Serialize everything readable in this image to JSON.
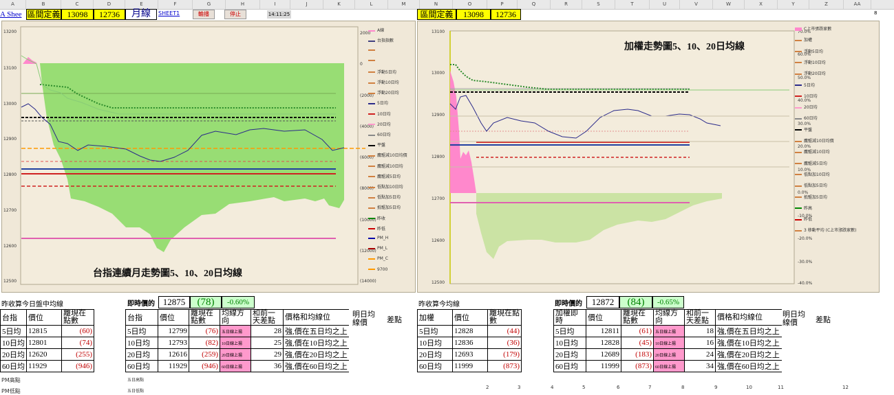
{
  "columns": [
    "A",
    "B",
    "C",
    "D",
    "E",
    "F",
    "G",
    "H",
    "I",
    "J",
    "K",
    "L",
    "M",
    "N",
    "O",
    "P",
    "Q",
    "R",
    "S",
    "T",
    "U",
    "V",
    "W",
    "X",
    "Y",
    "Z",
    "AA"
  ],
  "left_top": {
    "sheet_link": "A Shee",
    "label": "區間定義",
    "val1": "13098",
    "val2": "12736",
    "month_btn": "月線",
    "sheet_name": "SHEET1",
    "btn_rotate": "輪播",
    "btn_stop": "停止",
    "time": "14:11:25"
  },
  "right_top": {
    "label": "區間定義",
    "val1": "13098",
    "val2": "12736",
    "num8": "8"
  },
  "left_chart": {
    "title": "台指連續月走勢圖5、10、20日均線",
    "y_ticks": [
      "13200",
      "13100",
      "13000",
      "12900",
      "12800",
      "12700",
      "12600",
      "12500"
    ],
    "y2_ticks": [
      "2000",
      "0",
      "(2000)",
      "(4000)",
      "(6000)",
      "(8000)",
      "(10000)",
      "(12000)",
      "(14000)"
    ],
    "legend": [
      "A線",
      "台指指數",
      "",
      "",
      "浮動5日均",
      "浮動10日均",
      "浮動20日均",
      "5日均",
      "10日均",
      "20日均",
      "60日均",
      "平盤",
      "鷹驅減10日均價",
      "鷹驅減10日均",
      "鷹驅減5日均",
      "低點加10日均",
      "低點加5日均",
      "抵驅加5日均",
      "昨收",
      "昨低",
      "PM_H",
      "PM_L",
      "PM_C",
      "9700"
    ]
  },
  "right_chart": {
    "title": "加權走勢圖5、10、20日均線",
    "y_ticks": [
      "13100",
      "13000",
      "12900",
      "12800",
      "12700",
      "12600",
      "12500"
    ],
    "y2_ticks": [
      "70.0%",
      "60.0%",
      "50.0%",
      "40.0%",
      "30.0%",
      "20.0%",
      "10.0%",
      "0.0%",
      "-10.0%",
      "-20.0%",
      "-30.0%",
      "-40.0%"
    ],
    "legend": [
      "C上市張跌家數",
      "加權",
      "浮動5日均",
      "浮動10日均",
      "浮動20日均",
      "5日均",
      "10日均",
      "20日均",
      "60日均",
      "平盤",
      "鷹驅減10日均價",
      "鷹驅減10日均",
      "鷹驅減5日均",
      "低點加10日均",
      "低點加5日均",
      "抵驅加5日均",
      "昨高",
      "昨低",
      "3 移動平均 (C上市漲跌家數)"
    ]
  },
  "left_table1": {
    "title": "昨收算今日盤中均線",
    "headers": [
      "台指",
      "價位",
      "離現在點數"
    ],
    "rows": [
      [
        "5日均",
        "12815",
        "(60)"
      ],
      [
        "10日均",
        "12801",
        "(74)"
      ],
      [
        "20日均",
        "12620",
        "(255)"
      ],
      [
        "60日均",
        "11929",
        "(946)"
      ]
    ]
  },
  "left_table2": {
    "price_label": "即時價的",
    "price": "12875",
    "chg": "(78)",
    "pct": "-0.60%",
    "headers": [
      "台指",
      "價位",
      "離現在點數",
      "均線方向",
      "和前一天差點",
      "價格和均線位",
      "明日均線價",
      "差點"
    ],
    "rows": [
      [
        "5日均",
        "12799",
        "(76)",
        "五日線上揚",
        "28",
        "強,價在五日均之上"
      ],
      [
        "10日均",
        "12793",
        "(82)",
        "10日線上揚",
        "25",
        "強,價在10日均之上"
      ],
      [
        "20日均",
        "12616",
        "(259)",
        "20日線上揚",
        "29",
        "強,價在20日均之上"
      ],
      [
        "60日均",
        "11929",
        "(946)",
        "60日線上揚",
        "36",
        "強,價在60日均之上"
      ]
    ]
  },
  "right_table1": {
    "title": "昨收算今均線",
    "headers": [
      "加權",
      "價位",
      "離現在點數"
    ],
    "rows": [
      [
        "5日均",
        "12828",
        "(44)"
      ],
      [
        "10日均",
        "12836",
        "(36)"
      ],
      [
        "20日均",
        "12693",
        "(179)"
      ],
      [
        "60日均",
        "11999",
        "(873)"
      ]
    ]
  },
  "right_table2": {
    "price_label": "即時價的",
    "price": "12872",
    "chg": "(84)",
    "pct": "-0.65%",
    "headers": [
      "加權即時",
      "價位",
      "離現在點數",
      "均線方向",
      "和前一天差點",
      "價格和均線位",
      "明日均線價",
      "差點"
    ],
    "rows": [
      [
        "5日均",
        "12811",
        "(61)",
        "五日線上揚",
        "18",
        "強,價在五日均之上"
      ],
      [
        "10日均",
        "12828",
        "(45)",
        "10日線上揚",
        "16",
        "強,價在10日均之上"
      ],
      [
        "20日均",
        "12689",
        "(183)",
        "20日線上揚",
        "24",
        "強,價在20日均之上"
      ],
      [
        "60日均",
        "11999",
        "(873)",
        "60日線上揚",
        "34",
        "強,價在60日均之上"
      ]
    ]
  },
  "bottom": {
    "pm_high": "PM高點",
    "pm_low": "PM低點",
    "five_high": "五日高點",
    "five_low": "五日低點",
    "nums": [
      "2",
      "3",
      "4",
      "5",
      "6",
      "7",
      "8",
      "9",
      "10",
      "11",
      "12"
    ]
  },
  "colors": {
    "accent_yellow": "#ffff00",
    "green_area": "#90dd70",
    "pink": "#ff88cc",
    "chart_bg": "#f0e8d8"
  }
}
